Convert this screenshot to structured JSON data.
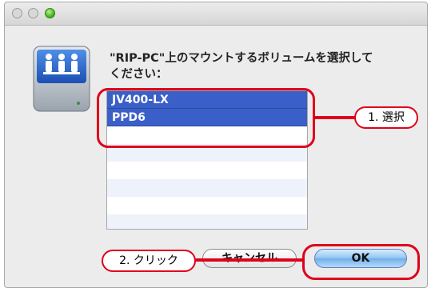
{
  "window": {
    "controls": [
      "close",
      "minimize",
      "zoom"
    ]
  },
  "dialog": {
    "icon": "network-disk-icon",
    "prompt_line1": "\"RIP-PC\"上のマウントするボリュームを選択して",
    "prompt_line2": "ください："
  },
  "volumes": [
    {
      "label": "JV400-LX",
      "selected": true
    },
    {
      "label": "PPD6",
      "selected": true
    }
  ],
  "buttons": {
    "cancel_label": "キャンセル",
    "ok_label": "OK"
  },
  "annotations": {
    "step1": "1. 選択",
    "step2": "2. クリック"
  },
  "colors": {
    "annotation_red": "#e0001b",
    "selection_blue": "#3a5fc8"
  }
}
